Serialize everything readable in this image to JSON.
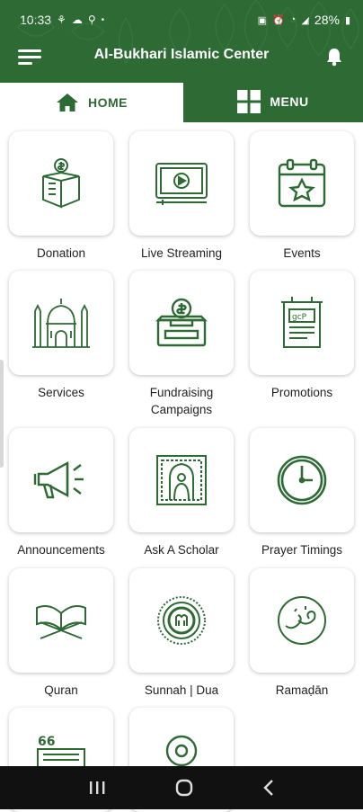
{
  "status_bar": {
    "time": "10:33",
    "battery": "28%"
  },
  "app_bar": {
    "title": "Al-Bukhari Islamic Center"
  },
  "tabs": [
    {
      "label": "HOME",
      "icon": "home-icon"
    },
    {
      "label": "MENU",
      "icon": "grid-icon"
    }
  ],
  "tiles": [
    {
      "label": "Donation",
      "icon": "donation-box-icon"
    },
    {
      "label": "Live Streaming",
      "icon": "video-play-icon"
    },
    {
      "label": "Events",
      "icon": "calendar-star-icon"
    },
    {
      "label": "Services",
      "icon": "mosque-icon"
    },
    {
      "label": "Fundraising Campaigns",
      "icon": "dollar-box-icon"
    },
    {
      "label": "Promotions",
      "icon": "poster-icon"
    },
    {
      "label": "Announcements",
      "icon": "megaphone-icon"
    },
    {
      "label": "Ask A Scholar",
      "icon": "scholar-icon"
    },
    {
      "label": "Prayer Timings",
      "icon": "clock-icon"
    },
    {
      "label": "Quran",
      "icon": "quran-icon"
    },
    {
      "label": "Sunnah | Dua",
      "icon": "emblem-icon"
    },
    {
      "label": "Ramaḍān",
      "icon": "ramadan-calligraphy-icon"
    },
    {
      "label": "",
      "icon": "quote-icon"
    },
    {
      "label": "",
      "icon": "location-icon"
    }
  ],
  "colors": {
    "primary": "#2e6a34",
    "icon": "#2e6a34"
  }
}
